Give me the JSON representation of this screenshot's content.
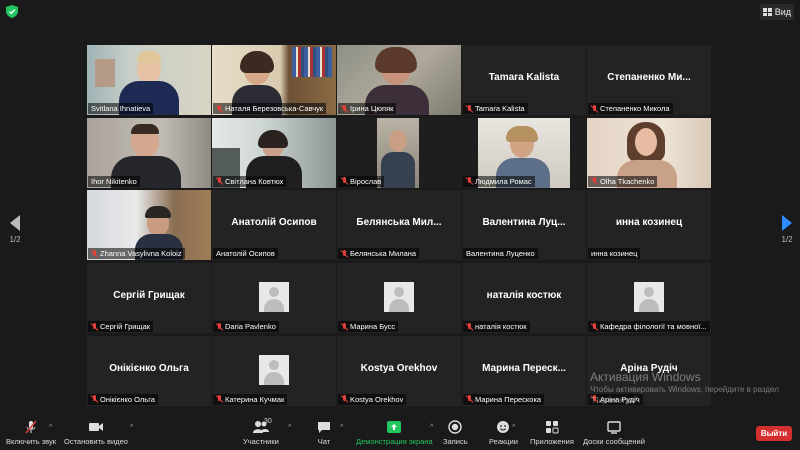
{
  "header": {
    "view_label": "Вид"
  },
  "nav": {
    "page_indicator_left": "1/2",
    "page_indicator_right": "1/2"
  },
  "tiles": [
    {
      "label": "Svitlana Ihnatieva",
      "muted": false,
      "video": true,
      "active": true,
      "big_name": ""
    },
    {
      "label": "Наталя Березовська-Савчук",
      "muted": true,
      "video": true,
      "big_name": ""
    },
    {
      "label": "Ірина Цюпяк",
      "muted": true,
      "video": true,
      "big_name": ""
    },
    {
      "label": "Tamara Kalista",
      "muted": true,
      "video": false,
      "big_name": "Tamara Kalista"
    },
    {
      "label": "Степаненко Микола",
      "muted": true,
      "video": false,
      "big_name": "Степаненко  Ми..."
    },
    {
      "label": "Ihor Nikitenko",
      "muted": false,
      "video": true,
      "big_name": ""
    },
    {
      "label": "Світлана Ковтюх",
      "muted": true,
      "video": true,
      "big_name": ""
    },
    {
      "label": "Вірослав",
      "muted": true,
      "video": true,
      "big_name": ""
    },
    {
      "label": "Людмила Ромас",
      "muted": true,
      "video": true,
      "big_name": ""
    },
    {
      "label": "Olha Tkachenko",
      "muted": true,
      "video": true,
      "big_name": ""
    },
    {
      "label": "Zhanna Vasylivna Koloiz",
      "muted": true,
      "video": true,
      "big_name": ""
    },
    {
      "label": "Анатолій Осипов",
      "muted": false,
      "video": false,
      "big_name": "Анатолій Осипов"
    },
    {
      "label": "Белянська Милана",
      "muted": true,
      "video": false,
      "big_name": "Белянська  Мил..."
    },
    {
      "label": "Валентина Луценко",
      "muted": false,
      "video": false,
      "big_name": "Валентина  Луц..."
    },
    {
      "label": "инна козинец",
      "muted": false,
      "video": false,
      "big_name": "инна козинец"
    },
    {
      "label": "Сергій Грищак",
      "muted": true,
      "video": false,
      "big_name": "Сергій Грищак"
    },
    {
      "label": "Daria Pavlenko",
      "muted": true,
      "video": false,
      "avatar": true,
      "big_name": ""
    },
    {
      "label": "Марина Бусс",
      "muted": true,
      "video": false,
      "avatar": true,
      "big_name": ""
    },
    {
      "label": "наталія костюк",
      "muted": true,
      "video": false,
      "big_name": "наталія костюк"
    },
    {
      "label": "Кафедра філології та мовної...",
      "muted": true,
      "video": false,
      "avatar": true,
      "big_name": ""
    },
    {
      "label": "Онікієнко Ольга",
      "muted": true,
      "video": false,
      "big_name": "Онікієнко Ольга"
    },
    {
      "label": "Катерина Кучмак",
      "muted": true,
      "video": false,
      "avatar": true,
      "big_name": ""
    },
    {
      "label": "Kostya Orekhov",
      "muted": true,
      "video": false,
      "big_name": "Kostya Orekhov"
    },
    {
      "label": "Марина Перескока",
      "muted": true,
      "video": false,
      "big_name": "Марина  Переск..."
    },
    {
      "label": "Аріна Рудіч",
      "muted": true,
      "video": false,
      "big_name": "Аріна Рудіч"
    }
  ],
  "watermark": {
    "title": "Активация Windows",
    "subtitle": "Чтобы активировать Windows, перейдите в раздел \"Параметры\"."
  },
  "toolbar": {
    "mute_label": "Включить звук",
    "video_label": "Остановить видео",
    "participants_label": "Участники",
    "participants_count": "30",
    "chat_label": "Чат",
    "share_label": "Демонстрация экрана",
    "record_label": "Запись",
    "reactions_label": "Реакции",
    "apps_label": "Приложения",
    "whiteboard_label": "Доски сообщений",
    "leave_label": "Выйти"
  },
  "colors": {
    "accent": "#2d8cff",
    "share_green": "#22c55e",
    "leave_red": "#d32f2f",
    "muted_red": "#e0403a",
    "active_border": "#c9d86b"
  }
}
